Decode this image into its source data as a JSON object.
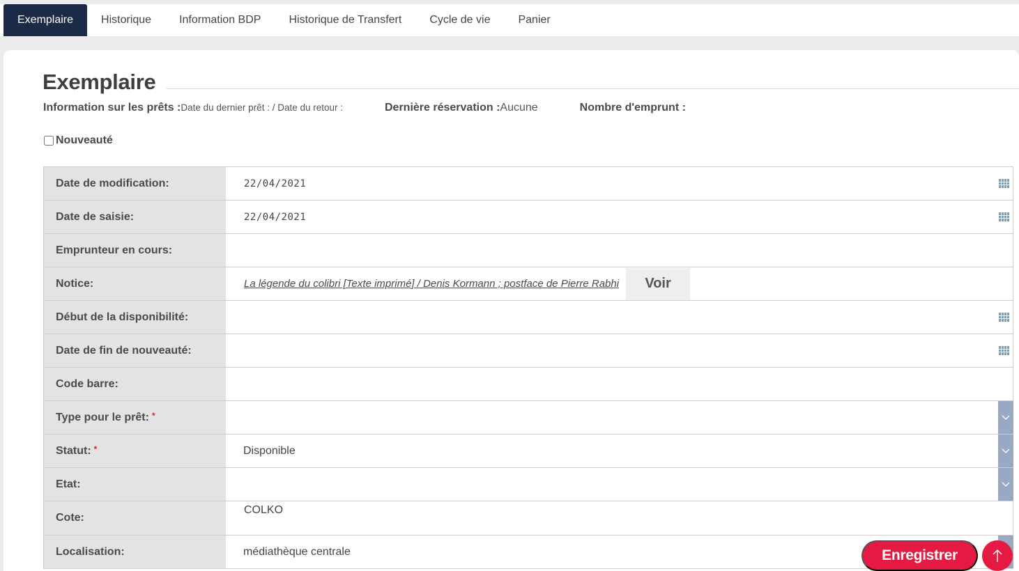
{
  "tabs": [
    {
      "label": "Exemplaire",
      "active": true
    },
    {
      "label": "Historique"
    },
    {
      "label": "Information BDP"
    },
    {
      "label": "Historique de Transfert"
    },
    {
      "label": "Cycle de vie"
    },
    {
      "label": "Panier"
    }
  ],
  "header": {
    "title": "Exemplaire"
  },
  "info": {
    "loans_label": "Information sur les prêts :",
    "loans_value": "Date du dernier prêt : / Date du retour :",
    "reservation_label": "Dernière réservation :",
    "reservation_value": "Aucune",
    "borrow_count_label": "Nombre d'emprunt :"
  },
  "nouveaute": {
    "label": "Nouveauté",
    "checked": false
  },
  "form": {
    "date_modification": {
      "label": "Date de modification:",
      "value": "22/04/2021"
    },
    "date_saisie": {
      "label": "Date de saisie:",
      "value": "22/04/2021"
    },
    "emprunteur": {
      "label": "Emprunteur en cours:",
      "value": ""
    },
    "notice": {
      "label": "Notice:",
      "value": "La légende du colibri [Texte imprimé] / Denis Kormann ; postface de Pierre Rabhi",
      "button": "Voir"
    },
    "debut_dispo": {
      "label": "Début de la disponibilité:",
      "value": ""
    },
    "fin_nouveaute": {
      "label": "Date de fin de nouveauté:",
      "value": ""
    },
    "code_barre": {
      "label": "Code barre:",
      "value": ""
    },
    "type_pret": {
      "label": "Type pour le prêt:",
      "required": "*",
      "value": ""
    },
    "statut": {
      "label": "Statut:",
      "required": "*",
      "value": "Disponible"
    },
    "etat": {
      "label": "Etat:",
      "value": ""
    },
    "cote": {
      "label": "Cote:",
      "value": "COLKO"
    },
    "localisation": {
      "label": "Localisation:",
      "value": "médiathèque centrale"
    }
  },
  "actions": {
    "save_label": "Enregistrer"
  },
  "colors": {
    "tab_active_bg": "#1c2a48",
    "save_button": "#e51a43",
    "dropdown_button": "#9aa9c3",
    "calendar_icon": "#6f9fc9"
  }
}
